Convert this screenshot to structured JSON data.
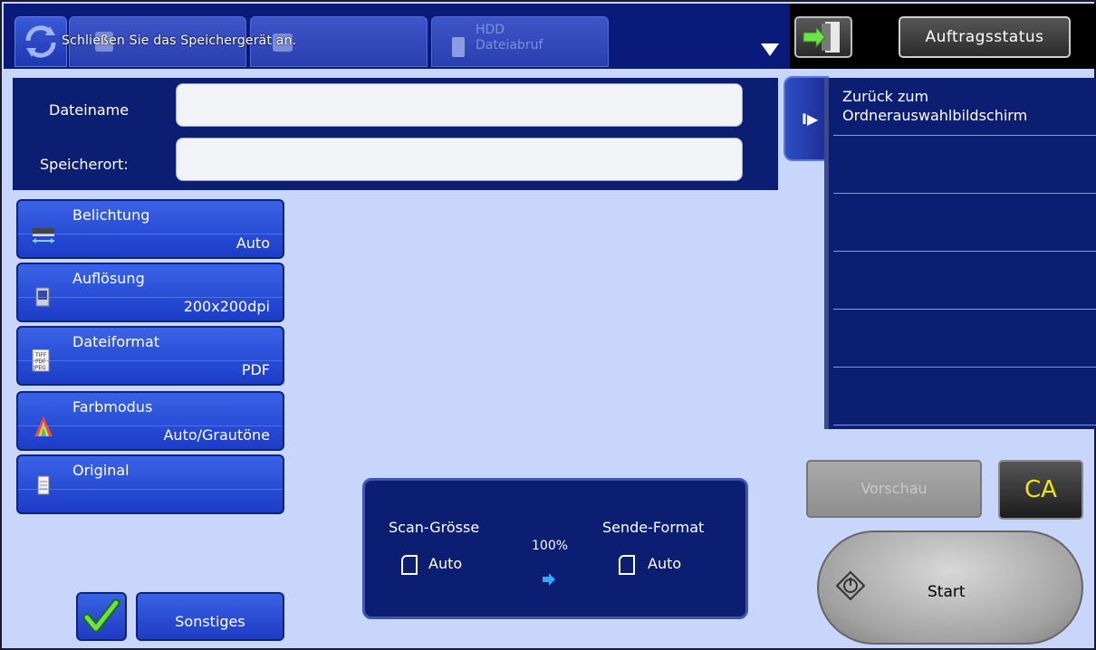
{
  "topbar": {
    "tab_hdd_label": "HDD\nDateiabruf",
    "message": "Schließen Sie das Speichergerät an.",
    "job_status_label": "Auftragsstatus"
  },
  "file_panel": {
    "filename_label": "Dateiname",
    "filename_value": "",
    "location_label": "Speicherort:",
    "location_value": ""
  },
  "destinations": {
    "items": [
      "Zurück zum Ordnerauswahlbildschirm",
      "",
      "",
      "",
      "",
      ""
    ]
  },
  "settings": [
    {
      "name": "Belichtung",
      "value": "Auto",
      "icon": "exposure-icon"
    },
    {
      "name": "Auflösung",
      "value": "200x200dpi",
      "icon": "resolution-icon"
    },
    {
      "name": "Dateiformat",
      "value": "PDF",
      "icon": "file-format-icon"
    },
    {
      "name": "Farbmodus",
      "value": "Auto/Grautöne",
      "icon": "color-mode-icon"
    },
    {
      "name": "Original",
      "value": "",
      "icon": "original-icon"
    }
  ],
  "bottom": {
    "other_label": "Sonstiges"
  },
  "scan": {
    "scan_size_label": "Scan-Grösse",
    "scan_size_value": "Auto",
    "ratio": "100%",
    "send_format_label": "Sende-Format",
    "send_format_value": "Auto"
  },
  "actions": {
    "preview_label": "Vorschau",
    "ca_label": "CA",
    "start_label": "Start"
  },
  "colors": {
    "panel_dark_blue": "#0c1e72",
    "button_blue": "#2a4fd8",
    "background": "#c9d6fb",
    "ca_yellow": "#f4e60a"
  }
}
